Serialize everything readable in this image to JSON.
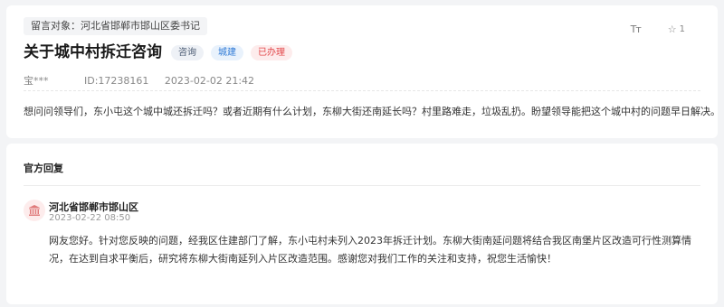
{
  "message": {
    "recipient_label": "留言对象：河北省邯郸市邯山区委书记",
    "title": "关于城中村拆迁咨询",
    "tags": {
      "type": "咨询",
      "category": "城建",
      "status": "已办理"
    },
    "font_size_icon": "Tт",
    "star_icon": "☆",
    "star_count": "1",
    "author": "宝***",
    "id_label": "ID:17238161",
    "datetime": "2023-02-02 21:42",
    "body": "想问问领导们，东小屯这个城中城还拆迁吗？或者近期有什么计划，东柳大街还南延长吗？村里路难走，垃圾乱扔。盼望领导能把这个城中村的问题早日解决。"
  },
  "reply": {
    "section_title": "官方回复",
    "org_icon": "government-building-icon",
    "org_name": "河北省邯郸市邯山区",
    "datetime": "2023-02-22 08:50",
    "body": "网友您好。针对您反映的问题，经我区住建部门了解，东小屯村未列入2023年拆迁计划。东柳大街南延问题将结合我区南堡片区改造可行性测算情况，在达到自求平衡后，研究将东柳大街南延列入片区改造范围。感谢您对我们工作的关注和支持，祝您生活愉快！"
  },
  "colors": {
    "page_bg": "#f3f4f6",
    "card_bg": "#ffffff",
    "tag_category": "#2f7ad6",
    "tag_status": "#e2474a",
    "org_icon": "#e07b7b"
  }
}
